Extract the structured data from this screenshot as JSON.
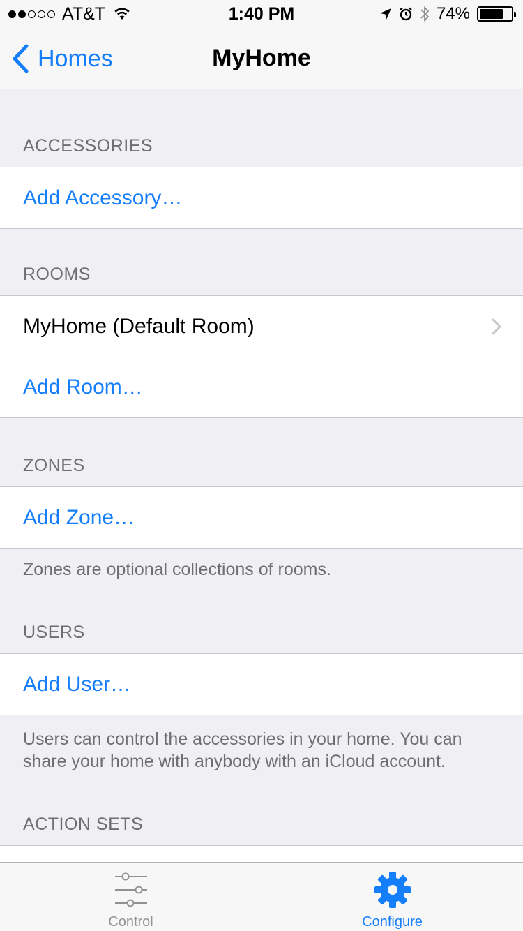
{
  "status_bar": {
    "carrier": "AT&T",
    "time": "1:40 PM",
    "battery_percent": "74%",
    "battery_level": 0.74,
    "signal_bars_filled": 2,
    "signal_bars_total": 5
  },
  "nav": {
    "back_label": "Homes",
    "title": "MyHome"
  },
  "sections": {
    "accessories": {
      "header": "ACCESSORIES",
      "add_label": "Add Accessory…"
    },
    "rooms": {
      "header": "ROOMS",
      "items": [
        "MyHome (Default Room)"
      ],
      "add_label": "Add Room…"
    },
    "zones": {
      "header": "ZONES",
      "add_label": "Add Zone…",
      "footer": "Zones are optional collections of rooms."
    },
    "users": {
      "header": "USERS",
      "add_label": "Add User…",
      "footer": "Users can control the accessories in your home. You can share your home with anybody with an iCloud account."
    },
    "action_sets": {
      "header": "ACTION SETS"
    }
  },
  "tabbar": {
    "tabs": [
      {
        "label": "Control",
        "icon": "sliders-icon",
        "active": false
      },
      {
        "label": "Configure",
        "icon": "gear-icon",
        "active": true
      }
    ]
  },
  "colors": {
    "accent": "#157efb",
    "background": "#efeff4",
    "secondary_text": "#6d6d72"
  }
}
